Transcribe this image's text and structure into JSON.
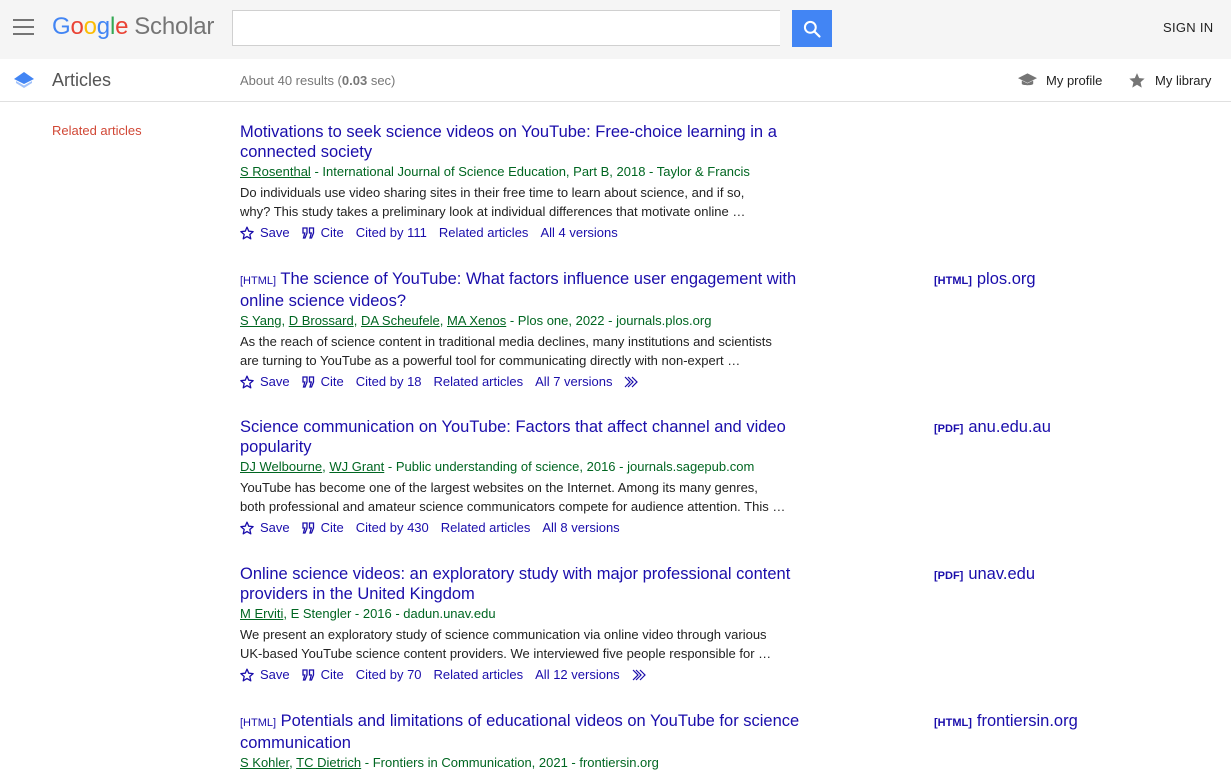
{
  "header": {
    "logo_google_letters": [
      "G",
      "o",
      "o",
      "g",
      "l",
      "e"
    ],
    "logo_scholar": "Scholar",
    "search_value": "",
    "search_placeholder": "",
    "sign_in": "SIGN IN"
  },
  "subbar": {
    "section_label": "Articles",
    "results_prefix": "About 40 results (",
    "results_time": "0.03",
    "results_suffix": " sec)",
    "my_profile": "My profile",
    "my_library": "My library"
  },
  "sidebar": {
    "related_articles": "Related articles"
  },
  "results": [
    {
      "tag": "",
      "title_line1": "Motivations to seek science videos on YouTube: Free-choice learning in a",
      "title_line2": "connected society",
      "authors": [
        "S Rosenthal"
      ],
      "plain_authors": "",
      "venue": " - International Journal of Science Education, Part B, 2018 - Taylor & Francis",
      "snippet_line1": "Do individuals use video sharing sites in their free time to learn about science, and if so,",
      "snippet_line2": "why? This study takes a preliminary look at individual differences that motivate online …",
      "save": "Save",
      "cite": "Cite",
      "cited_by": "Cited by 111",
      "related": "Related articles",
      "versions": "All 4 versions",
      "side_tag": "",
      "side_domain": ""
    },
    {
      "tag": "[HTML]",
      "title_line1": "The science of YouTube: What factors influence user engagement with",
      "title_line2": "online science videos?",
      "authors": [
        "S Yang",
        "D Brossard",
        "DA Scheufele",
        "MA Xenos"
      ],
      "plain_authors": "",
      "venue": " - Plos one, 2022 - journals.plos.org",
      "snippet_line1": "As the reach of science content in traditional media declines, many institutions and scientists",
      "snippet_line2": "are turning to YouTube as a powerful tool for communicating directly with non-expert …",
      "save": "Save",
      "cite": "Cite",
      "cited_by": "Cited by 18",
      "related": "Related articles",
      "versions": "All 7 versions",
      "side_tag": "[HTML]",
      "side_domain": "plos.org"
    },
    {
      "tag": "",
      "title_line1": "Science communication on YouTube: Factors that affect channel and video",
      "title_line2": "popularity",
      "authors": [
        "DJ Welbourne",
        "WJ Grant"
      ],
      "plain_authors": "",
      "venue": " - Public understanding of science, 2016 - journals.sagepub.com",
      "snippet_line1": "YouTube has become one of the largest websites on the Internet. Among its many genres,",
      "snippet_line2": "both professional and amateur science communicators compete for audience attention. This …",
      "save": "Save",
      "cite": "Cite",
      "cited_by": "Cited by 430",
      "related": "Related articles",
      "versions": "All 8 versions",
      "side_tag": "[PDF]",
      "side_domain": "anu.edu.au"
    },
    {
      "tag": "",
      "title_line1": "Online science videos: an exploratory study with major professional content",
      "title_line2": "providers in the United Kingdom",
      "authors": [
        "M Erviti"
      ],
      "plain_authors": ", E Stengler",
      "venue": " - 2016 - dadun.unav.edu",
      "snippet_line1": "We present an exploratory study of science communication via online video through various",
      "snippet_line2": "UK-based YouTube science content providers. We interviewed five people responsible for …",
      "save": "Save",
      "cite": "Cite",
      "cited_by": "Cited by 70",
      "related": "Related articles",
      "versions": "All 12 versions",
      "side_tag": "[PDF]",
      "side_domain": "unav.edu"
    },
    {
      "tag": "[HTML]",
      "title_line1": "Potentials and limitations of educational videos on YouTube for science",
      "title_line2": "communication",
      "authors": [
        "S Kohler",
        "TC Dietrich"
      ],
      "plain_authors": "",
      "venue": " - Frontiers in Communication, 2021 - frontiersin.org",
      "snippet_line1": "",
      "snippet_line2": "",
      "save": "",
      "cite": "",
      "cited_by": "",
      "related": "",
      "versions": "",
      "side_tag": "[HTML]",
      "side_domain": "frontiersin.org"
    }
  ],
  "colors": {
    "link": "#1a0dab",
    "green_meta": "#006621",
    "accent_red": "#d14836",
    "search_blue": "#4285f4"
  }
}
